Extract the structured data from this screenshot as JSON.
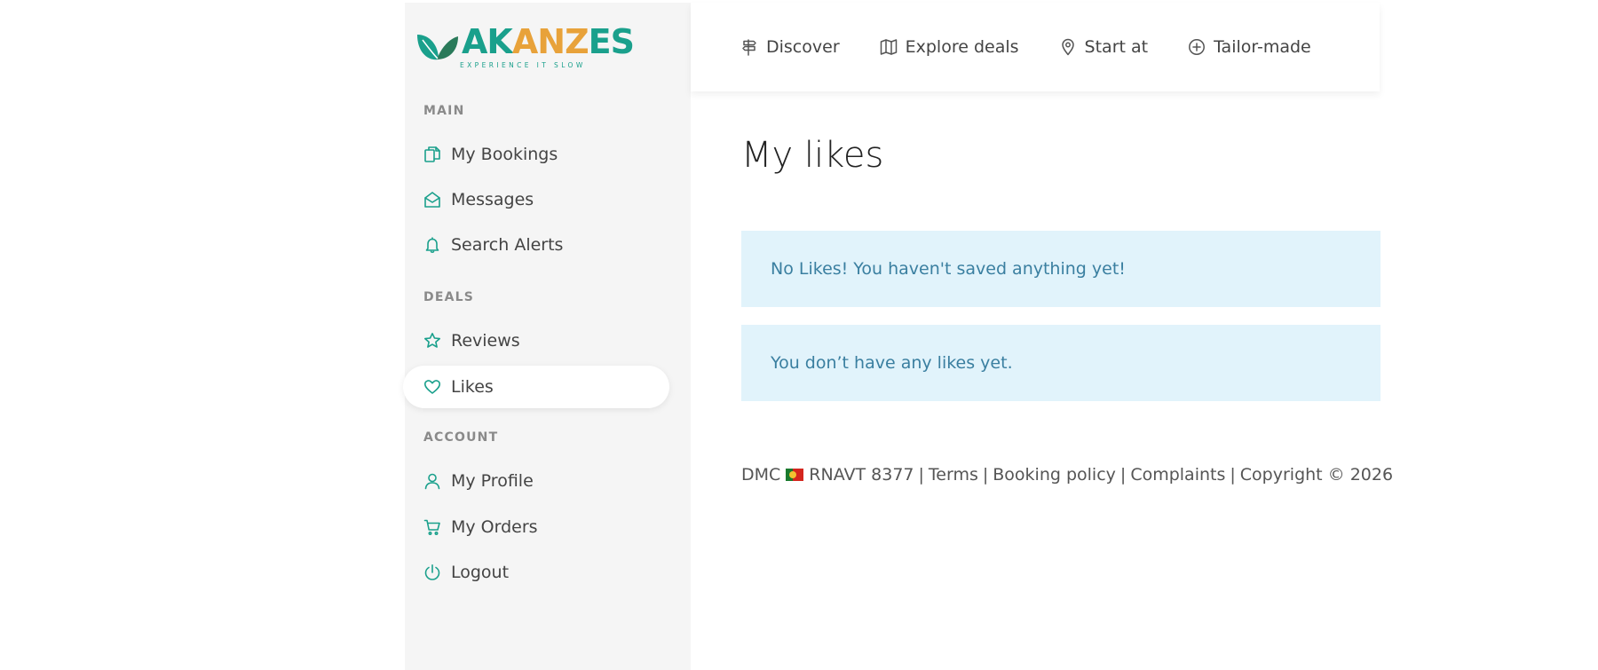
{
  "brand": {
    "logo_main": "AKANZES",
    "logo_parts": [
      "AK",
      "ANZ",
      "ES"
    ],
    "tagline": "EXPERIENCE IT SLOW",
    "accent_color": "#1aa08c"
  },
  "sidebar": {
    "sections": [
      {
        "title": "MAIN",
        "items": [
          {
            "label": "My Bookings",
            "icon": "documents-icon"
          },
          {
            "label": "Messages",
            "icon": "envelope-icon"
          },
          {
            "label": "Search Alerts",
            "icon": "bell-icon"
          }
        ]
      },
      {
        "title": "DEALS",
        "items": [
          {
            "label": "Reviews",
            "icon": "star-icon"
          },
          {
            "label": "Likes",
            "icon": "heart-icon",
            "active": true
          }
        ]
      },
      {
        "title": "ACCOUNT",
        "items": [
          {
            "label": "My Profile",
            "icon": "user-icon"
          },
          {
            "label": "My Orders",
            "icon": "cart-icon"
          },
          {
            "label": "Logout",
            "icon": "power-icon"
          }
        ]
      }
    ]
  },
  "topnav": {
    "items": [
      {
        "label": "Discover",
        "icon": "signpost-icon"
      },
      {
        "label": "Explore deals",
        "icon": "map-icon"
      },
      {
        "label": "Start at",
        "icon": "location-pin-icon"
      },
      {
        "label": "Tailor-made",
        "icon": "plus-circle-icon"
      }
    ]
  },
  "main": {
    "title": "My likes",
    "alerts": [
      "No Likes! You haven't saved anything yet!",
      "You don’t have any likes yet."
    ]
  },
  "footer": {
    "dmc_label": "DMC",
    "rnavt": "RNAVT 8377",
    "links": [
      "Terms",
      "Booking policy",
      "Complaints"
    ],
    "copyright": "Copyright © 2026"
  }
}
